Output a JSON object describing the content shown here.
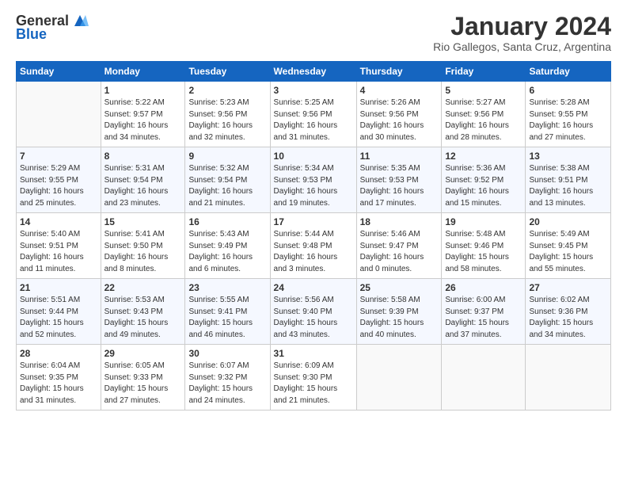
{
  "header": {
    "logo_line1": "General",
    "logo_line2": "Blue",
    "main_title": "January 2024",
    "sub_title": "Rio Gallegos, Santa Cruz, Argentina"
  },
  "calendar": {
    "days_of_week": [
      "Sunday",
      "Monday",
      "Tuesday",
      "Wednesday",
      "Thursday",
      "Friday",
      "Saturday"
    ],
    "weeks": [
      [
        {
          "day": "",
          "info": ""
        },
        {
          "day": "1",
          "info": "Sunrise: 5:22 AM\nSunset: 9:57 PM\nDaylight: 16 hours\nand 34 minutes."
        },
        {
          "day": "2",
          "info": "Sunrise: 5:23 AM\nSunset: 9:56 PM\nDaylight: 16 hours\nand 32 minutes."
        },
        {
          "day": "3",
          "info": "Sunrise: 5:25 AM\nSunset: 9:56 PM\nDaylight: 16 hours\nand 31 minutes."
        },
        {
          "day": "4",
          "info": "Sunrise: 5:26 AM\nSunset: 9:56 PM\nDaylight: 16 hours\nand 30 minutes."
        },
        {
          "day": "5",
          "info": "Sunrise: 5:27 AM\nSunset: 9:56 PM\nDaylight: 16 hours\nand 28 minutes."
        },
        {
          "day": "6",
          "info": "Sunrise: 5:28 AM\nSunset: 9:55 PM\nDaylight: 16 hours\nand 27 minutes."
        }
      ],
      [
        {
          "day": "7",
          "info": "Sunrise: 5:29 AM\nSunset: 9:55 PM\nDaylight: 16 hours\nand 25 minutes."
        },
        {
          "day": "8",
          "info": "Sunrise: 5:31 AM\nSunset: 9:54 PM\nDaylight: 16 hours\nand 23 minutes."
        },
        {
          "day": "9",
          "info": "Sunrise: 5:32 AM\nSunset: 9:54 PM\nDaylight: 16 hours\nand 21 minutes."
        },
        {
          "day": "10",
          "info": "Sunrise: 5:34 AM\nSunset: 9:53 PM\nDaylight: 16 hours\nand 19 minutes."
        },
        {
          "day": "11",
          "info": "Sunrise: 5:35 AM\nSunset: 9:53 PM\nDaylight: 16 hours\nand 17 minutes."
        },
        {
          "day": "12",
          "info": "Sunrise: 5:36 AM\nSunset: 9:52 PM\nDaylight: 16 hours\nand 15 minutes."
        },
        {
          "day": "13",
          "info": "Sunrise: 5:38 AM\nSunset: 9:51 PM\nDaylight: 16 hours\nand 13 minutes."
        }
      ],
      [
        {
          "day": "14",
          "info": "Sunrise: 5:40 AM\nSunset: 9:51 PM\nDaylight: 16 hours\nand 11 minutes."
        },
        {
          "day": "15",
          "info": "Sunrise: 5:41 AM\nSunset: 9:50 PM\nDaylight: 16 hours\nand 8 minutes."
        },
        {
          "day": "16",
          "info": "Sunrise: 5:43 AM\nSunset: 9:49 PM\nDaylight: 16 hours\nand 6 minutes."
        },
        {
          "day": "17",
          "info": "Sunrise: 5:44 AM\nSunset: 9:48 PM\nDaylight: 16 hours\nand 3 minutes."
        },
        {
          "day": "18",
          "info": "Sunrise: 5:46 AM\nSunset: 9:47 PM\nDaylight: 16 hours\nand 0 minutes."
        },
        {
          "day": "19",
          "info": "Sunrise: 5:48 AM\nSunset: 9:46 PM\nDaylight: 15 hours\nand 58 minutes."
        },
        {
          "day": "20",
          "info": "Sunrise: 5:49 AM\nSunset: 9:45 PM\nDaylight: 15 hours\nand 55 minutes."
        }
      ],
      [
        {
          "day": "21",
          "info": "Sunrise: 5:51 AM\nSunset: 9:44 PM\nDaylight: 15 hours\nand 52 minutes."
        },
        {
          "day": "22",
          "info": "Sunrise: 5:53 AM\nSunset: 9:43 PM\nDaylight: 15 hours\nand 49 minutes."
        },
        {
          "day": "23",
          "info": "Sunrise: 5:55 AM\nSunset: 9:41 PM\nDaylight: 15 hours\nand 46 minutes."
        },
        {
          "day": "24",
          "info": "Sunrise: 5:56 AM\nSunset: 9:40 PM\nDaylight: 15 hours\nand 43 minutes."
        },
        {
          "day": "25",
          "info": "Sunrise: 5:58 AM\nSunset: 9:39 PM\nDaylight: 15 hours\nand 40 minutes."
        },
        {
          "day": "26",
          "info": "Sunrise: 6:00 AM\nSunset: 9:37 PM\nDaylight: 15 hours\nand 37 minutes."
        },
        {
          "day": "27",
          "info": "Sunrise: 6:02 AM\nSunset: 9:36 PM\nDaylight: 15 hours\nand 34 minutes."
        }
      ],
      [
        {
          "day": "28",
          "info": "Sunrise: 6:04 AM\nSunset: 9:35 PM\nDaylight: 15 hours\nand 31 minutes."
        },
        {
          "day": "29",
          "info": "Sunrise: 6:05 AM\nSunset: 9:33 PM\nDaylight: 15 hours\nand 27 minutes."
        },
        {
          "day": "30",
          "info": "Sunrise: 6:07 AM\nSunset: 9:32 PM\nDaylight: 15 hours\nand 24 minutes."
        },
        {
          "day": "31",
          "info": "Sunrise: 6:09 AM\nSunset: 9:30 PM\nDaylight: 15 hours\nand 21 minutes."
        },
        {
          "day": "",
          "info": ""
        },
        {
          "day": "",
          "info": ""
        },
        {
          "day": "",
          "info": ""
        }
      ]
    ]
  }
}
